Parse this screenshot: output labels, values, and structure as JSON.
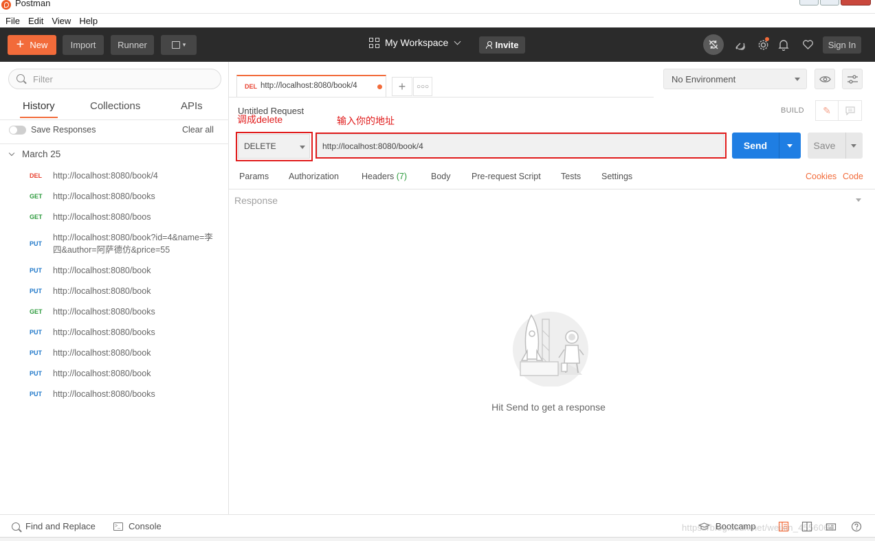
{
  "window": {
    "title": "Postman"
  },
  "menu": [
    "File",
    "Edit",
    "View",
    "Help"
  ],
  "header": {
    "new_label": "New",
    "import_label": "Import",
    "runner_label": "Runner",
    "workspace_label": "My Workspace",
    "invite_label": "Invite",
    "signin_label": "Sign In"
  },
  "sidebar": {
    "filter_placeholder": "Filter",
    "tabs": [
      "History",
      "Collections",
      "APIs"
    ],
    "active_tab": "History",
    "save_responses_label": "Save Responses",
    "clear_all_label": "Clear all",
    "group_label": "March 25",
    "history": [
      {
        "method": "DEL",
        "url": "http://localhost:8080/book/4"
      },
      {
        "method": "GET",
        "url": "http://localhost:8080/books"
      },
      {
        "method": "GET",
        "url": "http://localhost:8080/boos"
      },
      {
        "method": "PUT",
        "url": "http://localhost:8080/book?id=4&name=李四&author=阿萨德仿&price=55"
      },
      {
        "method": "PUT",
        "url": "http://localhost:8080/book"
      },
      {
        "method": "PUT",
        "url": "http://localhost:8080/book"
      },
      {
        "method": "GET",
        "url": "http://localhost:8080/books"
      },
      {
        "method": "PUT",
        "url": "http://localhost:8080/books"
      },
      {
        "method": "PUT",
        "url": "http://localhost:8080/book"
      },
      {
        "method": "PUT",
        "url": "http://localhost:8080/book"
      },
      {
        "method": "PUT",
        "url": "http://localhost:8080/books"
      }
    ]
  },
  "request_tab": {
    "method": "DEL",
    "url": "http://localhost:8080/book/4"
  },
  "environment": {
    "selected": "No Environment"
  },
  "request": {
    "title": "Untitled Request",
    "build_label": "BUILD",
    "method": "DELETE",
    "url": "http://localhost:8080/book/4",
    "send_label": "Send",
    "save_label": "Save"
  },
  "annotations": {
    "method_note": "调成delete",
    "url_note": "输入你的地址"
  },
  "request_subtabs": {
    "params": "Params",
    "authorization": "Authorization",
    "headers": "Headers",
    "headers_count": "(7)",
    "body": "Body",
    "prerequest": "Pre-request Script",
    "tests": "Tests",
    "settings": "Settings",
    "cookies": "Cookies",
    "code": "Code"
  },
  "response": {
    "label": "Response",
    "hint": "Hit Send to get a response"
  },
  "footer": {
    "find_replace": "Find and Replace",
    "console": "Console",
    "bootcamp": "Bootcamp",
    "watermark": "https://blog.csdn.net/weixin_4556064"
  },
  "colors": {
    "accent_orange": "#f26b3a",
    "send_blue": "#1f7ee3",
    "header_bg": "#2b2b2b",
    "annotation_red": "#e01b1b"
  }
}
